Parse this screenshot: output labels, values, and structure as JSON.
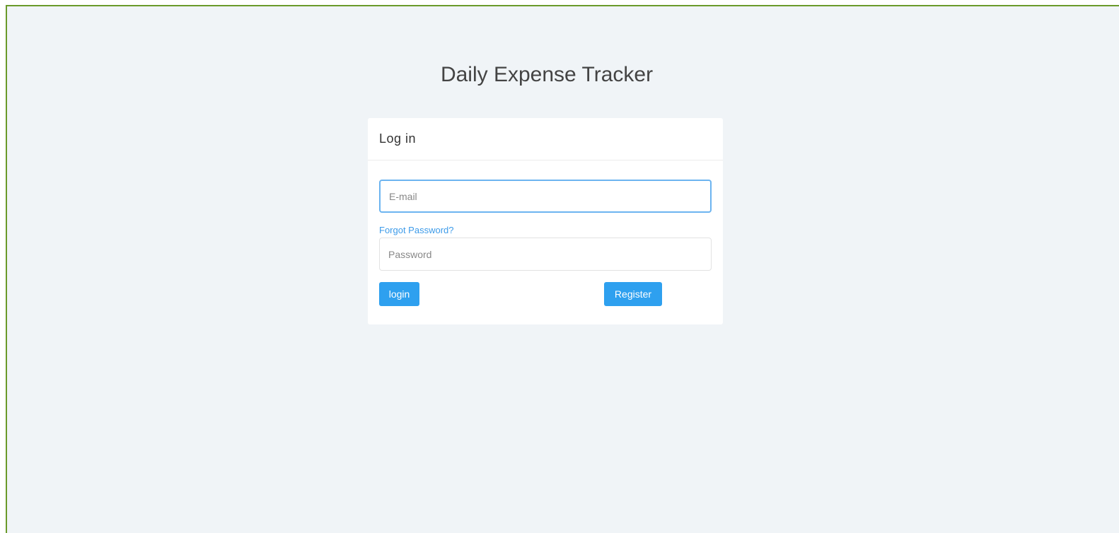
{
  "app": {
    "title": "Daily Expense Tracker"
  },
  "login_card": {
    "title": "Log in",
    "email": {
      "value": "",
      "placeholder": "E-mail"
    },
    "forgot_password_label": "Forgot Password?",
    "password": {
      "value": "",
      "placeholder": "Password"
    },
    "login_label": "login",
    "register_label": "Register"
  },
  "colors": {
    "background": "#f0f4f7",
    "button": "#2ea0ef",
    "link": "#3d9be9",
    "focus_border": "#6cb4f0",
    "frame_border": "#6a9a2a"
  }
}
